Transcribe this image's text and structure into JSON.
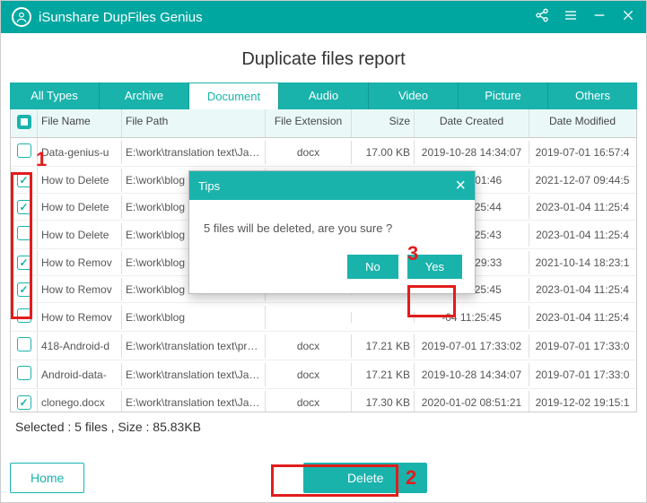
{
  "app": {
    "title": "iSunshare DupFiles Genius"
  },
  "page": {
    "heading": "Duplicate files report"
  },
  "tabs": [
    "All Types",
    "Archive",
    "Document",
    "Audio",
    "Video",
    "Picture",
    "Others"
  ],
  "active_tab": "Document",
  "columns": {
    "name": "File Name",
    "path": "File Path",
    "ext": "File Extension",
    "size": "Size",
    "created": "Date Created",
    "modified": "Date Modified"
  },
  "rows": [
    {
      "checked": false,
      "name": "Data-genius-u",
      "path": "E:\\work\\translation text\\Japan",
      "ext": "docx",
      "size": "17.00 KB",
      "created": "2019-10-28 14:34:07",
      "modified": "2019-07-01 16:57:4"
    },
    {
      "checked": true,
      "name": "How to Delete",
      "path": "E:\\work\\blog",
      "ext": "",
      "size": "",
      "created": "-06 10:01:46",
      "modified": "2021-12-07 09:44:5"
    },
    {
      "checked": true,
      "name": "How to Delete",
      "path": "E:\\work\\blog",
      "ext": "",
      "size": "",
      "created": "-04 11:25:44",
      "modified": "2023-01-04 11:25:4"
    },
    {
      "checked": false,
      "name": "How to Delete",
      "path": "E:\\work\\blog",
      "ext": "",
      "size": "",
      "created": "-04 11:25:43",
      "modified": "2023-01-04 11:25:4"
    },
    {
      "checked": true,
      "name": "How to Remov",
      "path": "E:\\work\\blog",
      "ext": "",
      "size": "",
      "created": "-14 10:29:33",
      "modified": "2021-10-14 18:23:1"
    },
    {
      "checked": true,
      "name": "How to Remov",
      "path": "E:\\work\\blog",
      "ext": "",
      "size": "",
      "created": "-04 11:25:45",
      "modified": "2023-01-04 11:25:4"
    },
    {
      "checked": false,
      "name": "How to Remov",
      "path": "E:\\work\\blog",
      "ext": "",
      "size": "",
      "created": "-04 11:25:45",
      "modified": "2023-01-04 11:25:4"
    },
    {
      "checked": false,
      "name": "418-Android-d",
      "path": "E:\\work\\translation text\\produ",
      "ext": "docx",
      "size": "17.21 KB",
      "created": "2019-07-01 17:33:02",
      "modified": "2019-07-01 17:33:0"
    },
    {
      "checked": false,
      "name": "Android-data-",
      "path": "E:\\work\\translation text\\Japan",
      "ext": "docx",
      "size": "17.21 KB",
      "created": "2019-10-28 14:34:07",
      "modified": "2019-07-01 17:33:0"
    },
    {
      "checked": true,
      "name": "clonego.docx",
      "path": "E:\\work\\translation text\\Japan",
      "ext": "docx",
      "size": "17.30 KB",
      "created": "2020-01-02 08:51:21",
      "modified": "2019-12-02 19:15:1"
    }
  ],
  "status": "Selected : 5  files ,  Size : 85.83KB",
  "buttons": {
    "home": "Home",
    "delete": "Delete"
  },
  "dialog": {
    "title": "Tips",
    "message": "5 files will be deleted, are you sure ?",
    "no": "No",
    "yes": "Yes"
  },
  "annotations": {
    "a1": "1",
    "a2": "2",
    "a3": "3"
  }
}
